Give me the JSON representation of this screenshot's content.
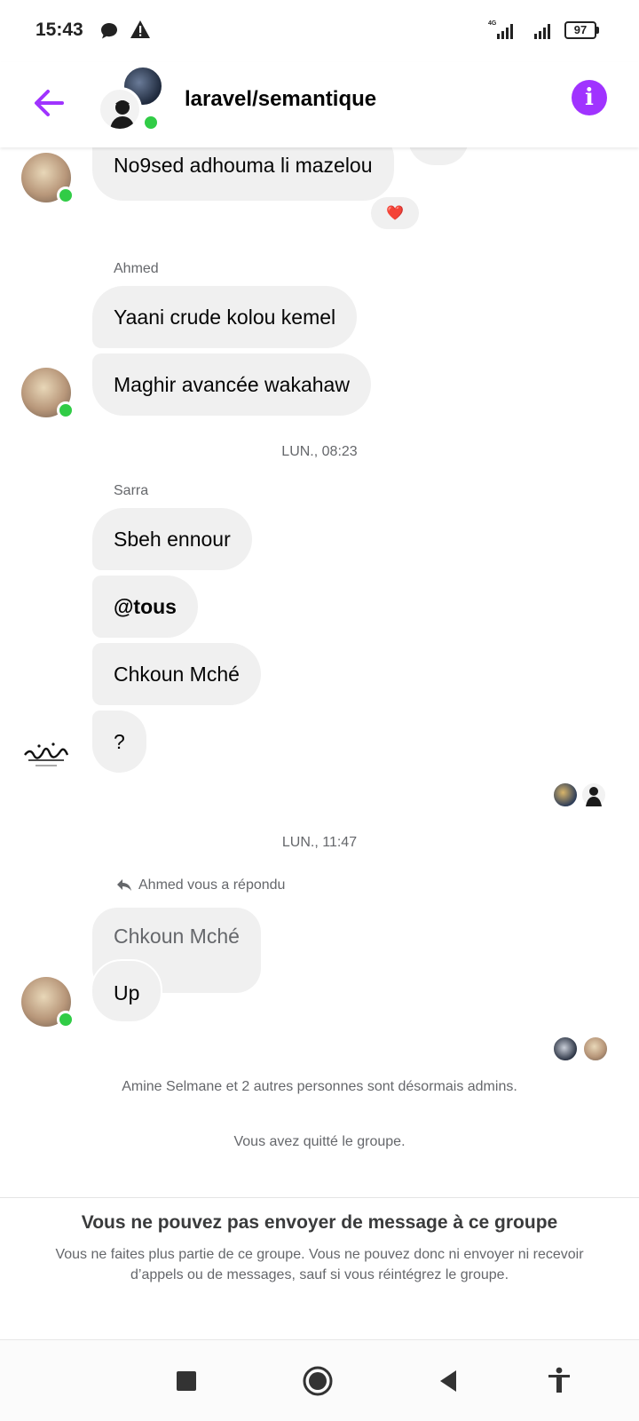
{
  "status_bar": {
    "time": "15:43",
    "network_label": "4G",
    "battery": "97"
  },
  "header": {
    "title": "laravel/semantique",
    "back_icon": "arrow-left-icon",
    "info_icon": "info-icon",
    "accent_color": "#a033ff"
  },
  "messages": {
    "top_bubble": "No9sed adhouma li mazelou",
    "top_reaction": "❤️",
    "ahmed_sender": "Ahmed",
    "ahmed_bubbles": [
      "Yaani crude kolou kemel",
      "Maghir avancée wakahaw"
    ],
    "timestamp_1": "LUN., 08:23",
    "sarra_sender": "Sarra",
    "sarra_bubbles": [
      "Sbeh ennour",
      "@tous",
      "Chkoun Mché",
      "?"
    ],
    "timestamp_2": "LUN., 11:47",
    "reply_note": "Ahmed vous a répondu",
    "quoted_text": "Chkoun Mché",
    "reply_text": "Up",
    "system_admins": "Amine Selmane et 2 autres personnes sont désormais admins.",
    "system_left": "Vous avez quitté le groupe."
  },
  "footer": {
    "title": "Vous ne pouvez pas envoyer de message à ce groupe",
    "body": "Vous ne faites plus partie de ce groupe. Vous ne pouvez donc ni envoyer ni recevoir d’appels ou de messages, sauf si vous réintégrez le groupe."
  },
  "colors": {
    "bubble": "#f0f0f0",
    "online": "#31cc46",
    "meta_text": "#65676b"
  }
}
